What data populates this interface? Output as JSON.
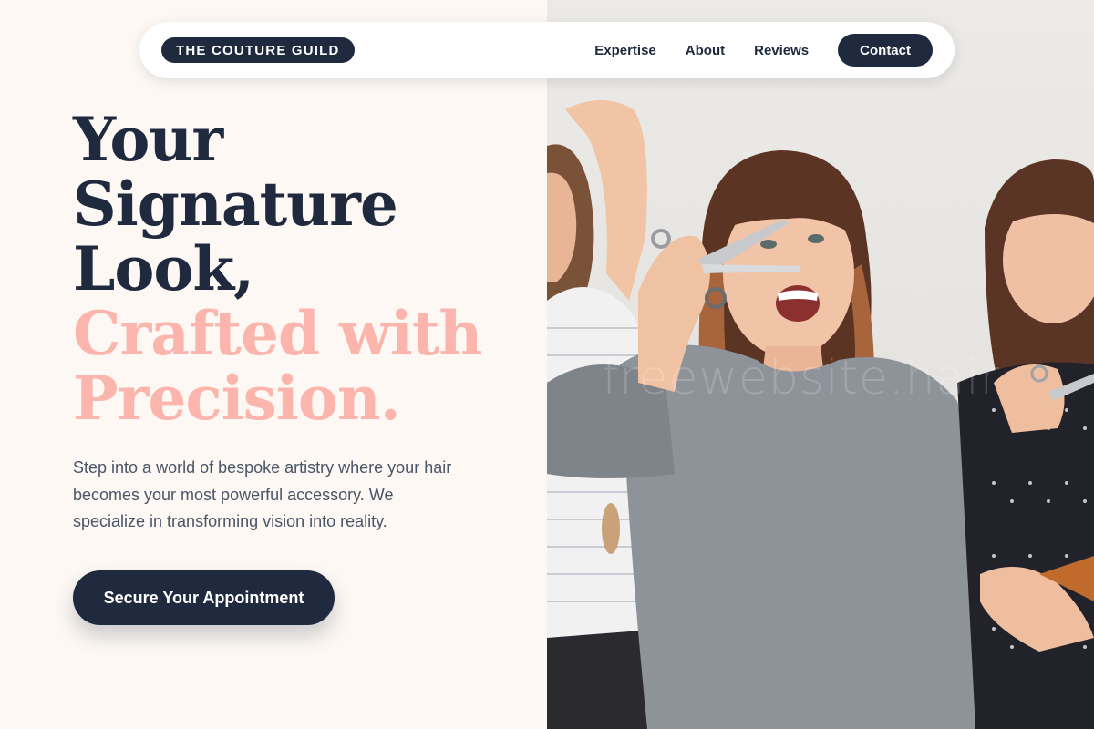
{
  "brand": {
    "label": "THE COUTURE GUILD"
  },
  "nav": {
    "items": [
      {
        "label": "Expertise"
      },
      {
        "label": "About"
      },
      {
        "label": "Reviews"
      }
    ],
    "contact_label": "Contact"
  },
  "hero": {
    "headline_dark": [
      "Your",
      "Signature",
      "Look,"
    ],
    "headline_accent": [
      "Crafted with",
      "Precision."
    ],
    "description": "Step into a world of bespoke artistry where your hair becomes your most powerful accessory. We specialize in transforming vision into reality.",
    "cta_label": "Secure Your Appointment"
  },
  "photo": {
    "watermark": "freewebsite.hair"
  },
  "colors": {
    "navy": "#1f2a3f",
    "accent_pink": "#fbb5ad",
    "cream": "#fdf8f3",
    "body_text": "#4a5567"
  }
}
